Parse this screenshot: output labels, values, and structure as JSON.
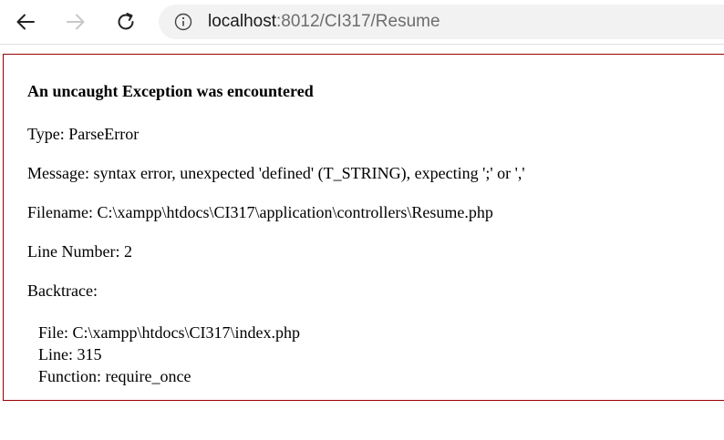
{
  "browser": {
    "url_host": "localhost",
    "url_path": ":8012/CI317/Resume"
  },
  "error": {
    "heading": "An uncaught Exception was encountered",
    "type": "Type: ParseError",
    "message": "Message: syntax error, unexpected 'defined' (T_STRING), expecting ';' or ','",
    "filename": "Filename: C:\\xampp\\htdocs\\CI317\\application\\controllers\\Resume.php",
    "line_number": "Line Number: 2",
    "backtrace_label": "Backtrace:",
    "trace": {
      "file": "File: C:\\xampp\\htdocs\\CI317\\index.php",
      "line": "Line: 315",
      "function": "Function: require_once"
    }
  }
}
